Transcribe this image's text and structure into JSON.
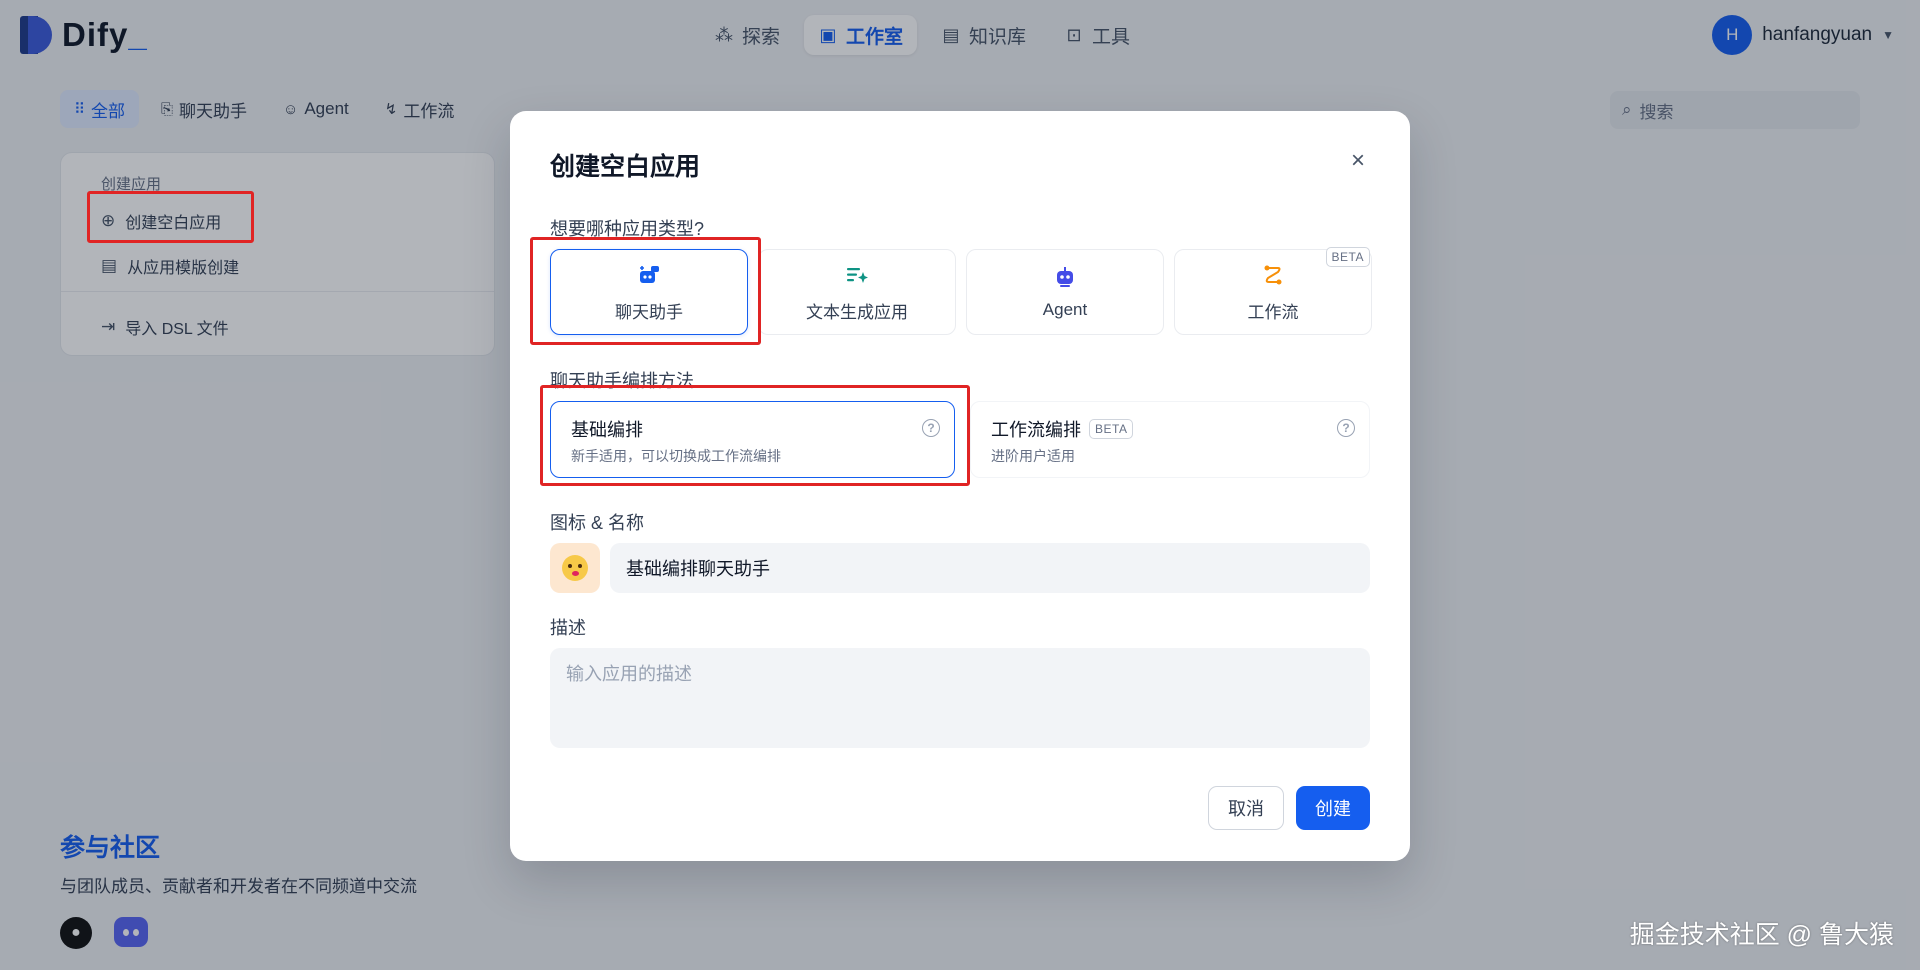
{
  "app": {
    "logo_text": "Dify",
    "logo_suffix": "_"
  },
  "nav": {
    "items": [
      {
        "label": "探索",
        "icon": "explore-icon"
      },
      {
        "label": "工作室",
        "icon": "robot-icon",
        "active": true
      },
      {
        "label": "知识库",
        "icon": "book-icon"
      },
      {
        "label": "工具",
        "icon": "toolbox-icon"
      }
    ]
  },
  "user": {
    "initial": "H",
    "name": "hanfangyuan"
  },
  "filters": {
    "items": [
      {
        "label": "全部",
        "icon": "grid-icon",
        "active": true
      },
      {
        "label": "聊天助手",
        "icon": "chat-icon"
      },
      {
        "label": "Agent",
        "icon": "agent-icon"
      },
      {
        "label": "工作流",
        "icon": "workflow-icon"
      }
    ]
  },
  "search": {
    "placeholder": "搜索"
  },
  "create_card": {
    "title": "创建应用",
    "blank": "创建空白应用",
    "template": "从应用模版创建",
    "import_dsl": "导入 DSL 文件"
  },
  "community": {
    "heading": "参与社区",
    "subtitle": "与团队成员、贡献者和开发者在不同频道中交流"
  },
  "watermark": "掘金技术社区 @ 鲁大猿",
  "modal": {
    "title": "创建空白应用",
    "type_label": "想要哪种应用类型?",
    "types": [
      {
        "label": "聊天助手",
        "icon": "chat-bot-icon",
        "selected": true,
        "color": "#155eef"
      },
      {
        "label": "文本生成应用",
        "icon": "text-generate-icon",
        "color": "#0e9384"
      },
      {
        "label": "Agent",
        "icon": "agent-robot-icon",
        "color": "#444ce7"
      },
      {
        "label": "工作流",
        "icon": "workflow-route-icon",
        "color": "#f79009"
      }
    ],
    "beta_label": "BETA",
    "mode_label": "聊天助手编排方法",
    "modes": [
      {
        "title": "基础编排",
        "desc": "新手适用，可以切换成工作流编排",
        "selected": true
      },
      {
        "title": "工作流编排",
        "desc": "进阶用户适用",
        "badge": "BETA"
      }
    ],
    "name_label": "图标 & 名称",
    "name_value": "基础编排聊天助手",
    "desc_label": "描述",
    "desc_placeholder": "输入应用的描述",
    "cancel": "取消",
    "create": "创建"
  }
}
